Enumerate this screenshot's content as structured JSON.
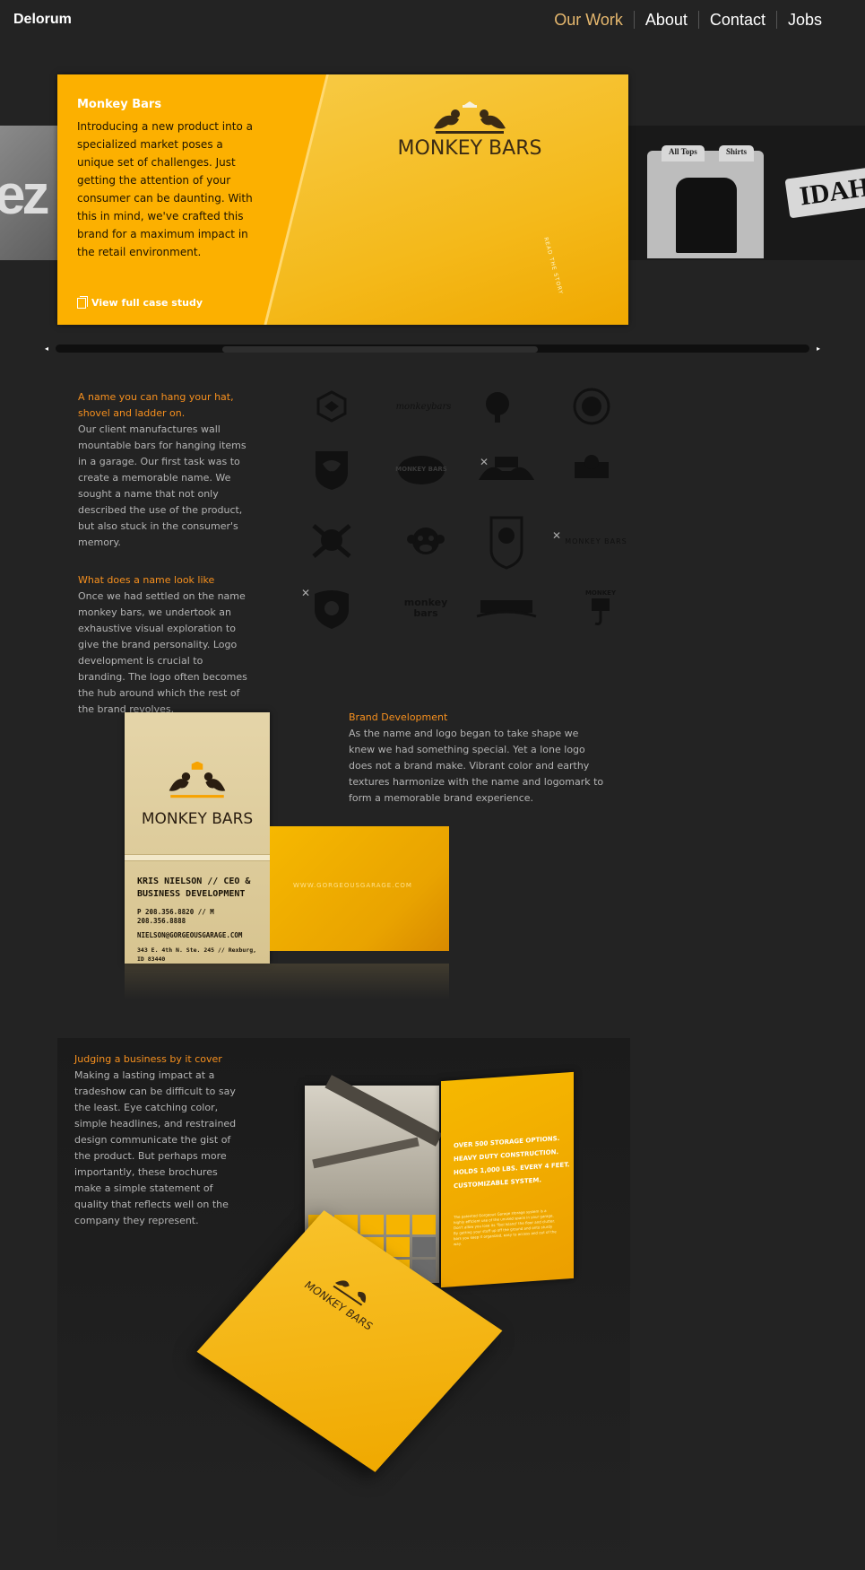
{
  "header": {
    "brand": "Delorum",
    "nav": [
      {
        "label": "Our Work",
        "active": true
      },
      {
        "label": "About",
        "active": false
      },
      {
        "label": "Contact",
        "active": false
      },
      {
        "label": "Jobs",
        "active": false
      }
    ]
  },
  "carousel": {
    "left_thumb_text": "ez",
    "right_thumb": {
      "tabs": [
        "All Tops",
        "Shirts"
      ],
      "badge": "IDAH"
    },
    "hero": {
      "title": "Monkey Bars",
      "description": "Introducing a new product into a specialized market poses a unique set of challenges. Just getting the attention of your consumer can be daunting. With this in mind, we've crafted this brand for a maximum impact in the retail environment.",
      "link": "View full case study",
      "wordmark": "MONKEY BARS",
      "tag": "READ THE STORY"
    },
    "scroll_prev": "◂",
    "scroll_next": "▸"
  },
  "section_naming": {
    "heading1": "A name you can hang your hat, shovel and ladder on.",
    "text1": "Our client manufactures wall mountable bars for hanging items in a garage. Our first task was to create a memorable name. We sought a name that not only described the use of the product, but also stuck in the consumer's memory.",
    "heading2": "What does a name look like",
    "text2": "Once we had settled on the name monkey bars, we undertook an exhaustive visual exploration to give the brand personality. Logo development is crucial to branding. The logo often becomes the hub around which the rest of the brand revolves."
  },
  "logo_grid": {
    "x_mark": "✕",
    "labels": {
      "monkeybars_script": "monkeybars",
      "monkey_bars_badge": "MONKEY BARS",
      "monkey_bars_inline": "MONKEY BARS",
      "monkey": "monkey",
      "bars": "bars",
      "monkey_bars_stack": "MONKEY"
    }
  },
  "business_card": {
    "wordmark": "MONKEY BARS",
    "name": "KRIS NIELSON // CEO &",
    "title": "BUSINESS DEVELOPMENT",
    "phone": "P 208.356.8820 // M 208.356.8888",
    "email": "NIELSON@GORGEOUSGARAGE.COM",
    "address": "343 E. 4th N. Ste. 245 // Rexburg, ID 83440",
    "back_url": "WWW.GORGEOUSGARAGE.COM"
  },
  "section_brand": {
    "heading": "Brand Development",
    "text": "As the name and logo began to take shape we knew we had something special. Yet a lone logo does not a brand make. Vibrant color and earthy textures harmonize with the name and logomark to form a memorable brand experience."
  },
  "section_cover": {
    "heading": "Judging a business by it cover",
    "text": "Making a lasting impact at a tradeshow can be difficult to say the least. Eye catching color, simple headlines, and restrained design communicate the gist of the product. But perhaps more importantly, these brochures make a simple statement of quality that reflects well on the company they represent."
  },
  "brochure": {
    "lines": [
      "OVER 500 STORAGE OPTIONS.",
      "HEAVY DUTY CONSTRUCTION.",
      "HOLDS 1,000 LBS. EVERY 4 FEET.",
      "CUSTOMIZABLE SYSTEM."
    ],
    "body": "The patented Gorgeous Garage storage system is a highly efficient use of the unused space in your garage. Don't allow you lose its 'Tool Island' the floor and clutter. By getting your stuff up off the ground and onto sturdy bars you keep it organized, easy to access and out of the way.",
    "cover_wordmark": "MONKEY BARS"
  },
  "colors": {
    "background": "#232323",
    "accent_orange": "#f7901e",
    "brand_yellow": "#fcb000",
    "nav_active": "#e6b86e"
  }
}
